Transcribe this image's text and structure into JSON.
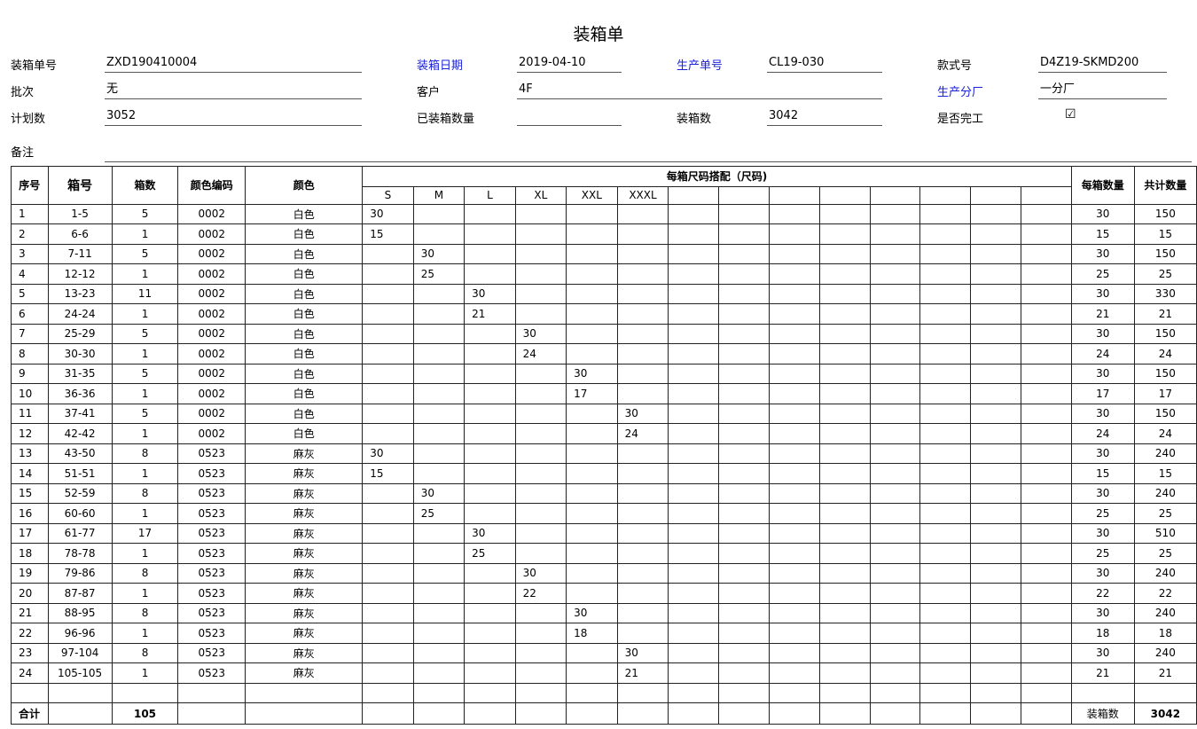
{
  "title": "装箱单",
  "header": {
    "row1": [
      {
        "label": "装箱单号",
        "value": "ZXD190410004",
        "blue": false
      },
      {
        "label": "装箱日期",
        "value": "2019-04-10",
        "blue": true
      },
      {
        "label": "生产单号",
        "value": "CL19-030",
        "blue": true
      },
      {
        "label": "款式号",
        "value": "D4Z19-SKMD200",
        "blue": false
      }
    ],
    "row2": [
      {
        "label": "批次",
        "value": "无",
        "blue": false
      },
      {
        "label": "客户",
        "value": "4F",
        "blue": false
      },
      {
        "label": "生产分厂",
        "value": "一分厂",
        "blue": true
      }
    ],
    "row3": [
      {
        "label": "计划数",
        "value": "3052",
        "blue": false
      },
      {
        "label": "已装箱数量",
        "value": "",
        "blue": false
      },
      {
        "label": "装箱数",
        "value": "3042",
        "blue": false
      },
      {
        "label": "是否完工",
        "value": "☑",
        "blue": false
      }
    ],
    "remark_label": "备注",
    "remark_value": ""
  },
  "table": {
    "headers": {
      "seq": "序号",
      "box_no": "箱号",
      "box_count": "箱数",
      "color_code": "颜色编码",
      "color": "颜色",
      "size_group": "每箱尺码搭配（尺码)",
      "per_box": "每箱数量",
      "total": "共计数量"
    },
    "sizes": [
      "S",
      "M",
      "L",
      "XL",
      "XXL",
      "XXXL",
      "",
      "",
      "",
      "",
      "",
      "",
      "",
      ""
    ],
    "rows": [
      {
        "seq": "1",
        "box_no": "1-5",
        "count": "5",
        "code": "0002",
        "color": "白色",
        "size": 0,
        "qty": "30",
        "per": "30",
        "total": "150"
      },
      {
        "seq": "2",
        "box_no": "6-6",
        "count": "1",
        "code": "0002",
        "color": "白色",
        "size": 0,
        "qty": "15",
        "per": "15",
        "total": "15"
      },
      {
        "seq": "3",
        "box_no": "7-11",
        "count": "5",
        "code": "0002",
        "color": "白色",
        "size": 1,
        "qty": "30",
        "per": "30",
        "total": "150"
      },
      {
        "seq": "4",
        "box_no": "12-12",
        "count": "1",
        "code": "0002",
        "color": "白色",
        "size": 1,
        "qty": "25",
        "per": "25",
        "total": "25"
      },
      {
        "seq": "5",
        "box_no": "13-23",
        "count": "11",
        "code": "0002",
        "color": "白色",
        "size": 2,
        "qty": "30",
        "per": "30",
        "total": "330"
      },
      {
        "seq": "6",
        "box_no": "24-24",
        "count": "1",
        "code": "0002",
        "color": "白色",
        "size": 2,
        "qty": "21",
        "per": "21",
        "total": "21"
      },
      {
        "seq": "7",
        "box_no": "25-29",
        "count": "5",
        "code": "0002",
        "color": "白色",
        "size": 3,
        "qty": "30",
        "per": "30",
        "total": "150"
      },
      {
        "seq": "8",
        "box_no": "30-30",
        "count": "1",
        "code": "0002",
        "color": "白色",
        "size": 3,
        "qty": "24",
        "per": "24",
        "total": "24"
      },
      {
        "seq": "9",
        "box_no": "31-35",
        "count": "5",
        "code": "0002",
        "color": "白色",
        "size": 4,
        "qty": "30",
        "per": "30",
        "total": "150"
      },
      {
        "seq": "10",
        "box_no": "36-36",
        "count": "1",
        "code": "0002",
        "color": "白色",
        "size": 4,
        "qty": "17",
        "per": "17",
        "total": "17"
      },
      {
        "seq": "11",
        "box_no": "37-41",
        "count": "5",
        "code": "0002",
        "color": "白色",
        "size": 5,
        "qty": "30",
        "per": "30",
        "total": "150"
      },
      {
        "seq": "12",
        "box_no": "42-42",
        "count": "1",
        "code": "0002",
        "color": "白色",
        "size": 5,
        "qty": "24",
        "per": "24",
        "total": "24"
      },
      {
        "seq": "13",
        "box_no": "43-50",
        "count": "8",
        "code": "0523",
        "color": "麻灰",
        "size": 0,
        "qty": "30",
        "per": "30",
        "total": "240"
      },
      {
        "seq": "14",
        "box_no": "51-51",
        "count": "1",
        "code": "0523",
        "color": "麻灰",
        "size": 0,
        "qty": "15",
        "per": "15",
        "total": "15"
      },
      {
        "seq": "15",
        "box_no": "52-59",
        "count": "8",
        "code": "0523",
        "color": "麻灰",
        "size": 1,
        "qty": "30",
        "per": "30",
        "total": "240"
      },
      {
        "seq": "16",
        "box_no": "60-60",
        "count": "1",
        "code": "0523",
        "color": "麻灰",
        "size": 1,
        "qty": "25",
        "per": "25",
        "total": "25"
      },
      {
        "seq": "17",
        "box_no": "61-77",
        "count": "17",
        "code": "0523",
        "color": "麻灰",
        "size": 2,
        "qty": "30",
        "per": "30",
        "total": "510"
      },
      {
        "seq": "18",
        "box_no": "78-78",
        "count": "1",
        "code": "0523",
        "color": "麻灰",
        "size": 2,
        "qty": "25",
        "per": "25",
        "total": "25"
      },
      {
        "seq": "19",
        "box_no": "79-86",
        "count": "8",
        "code": "0523",
        "color": "麻灰",
        "size": 3,
        "qty": "30",
        "per": "30",
        "total": "240"
      },
      {
        "seq": "20",
        "box_no": "87-87",
        "count": "1",
        "code": "0523",
        "color": "麻灰",
        "size": 3,
        "qty": "22",
        "per": "22",
        "total": "22"
      },
      {
        "seq": "21",
        "box_no": "88-95",
        "count": "8",
        "code": "0523",
        "color": "麻灰",
        "size": 4,
        "qty": "30",
        "per": "30",
        "total": "240"
      },
      {
        "seq": "22",
        "box_no": "96-96",
        "count": "1",
        "code": "0523",
        "color": "麻灰",
        "size": 4,
        "qty": "18",
        "per": "18",
        "total": "18"
      },
      {
        "seq": "23",
        "box_no": "97-104",
        "count": "8",
        "code": "0523",
        "color": "麻灰",
        "size": 5,
        "qty": "30",
        "per": "30",
        "total": "240"
      },
      {
        "seq": "24",
        "box_no": "105-105",
        "count": "1",
        "code": "0523",
        "color": "麻灰",
        "size": 5,
        "qty": "21",
        "per": "21",
        "total": "21"
      }
    ],
    "footer": {
      "label": "合计",
      "box_count": "105",
      "per_label": "装箱数",
      "total": "3042"
    }
  },
  "colors": {
    "blue_label": "#1b22d8"
  }
}
